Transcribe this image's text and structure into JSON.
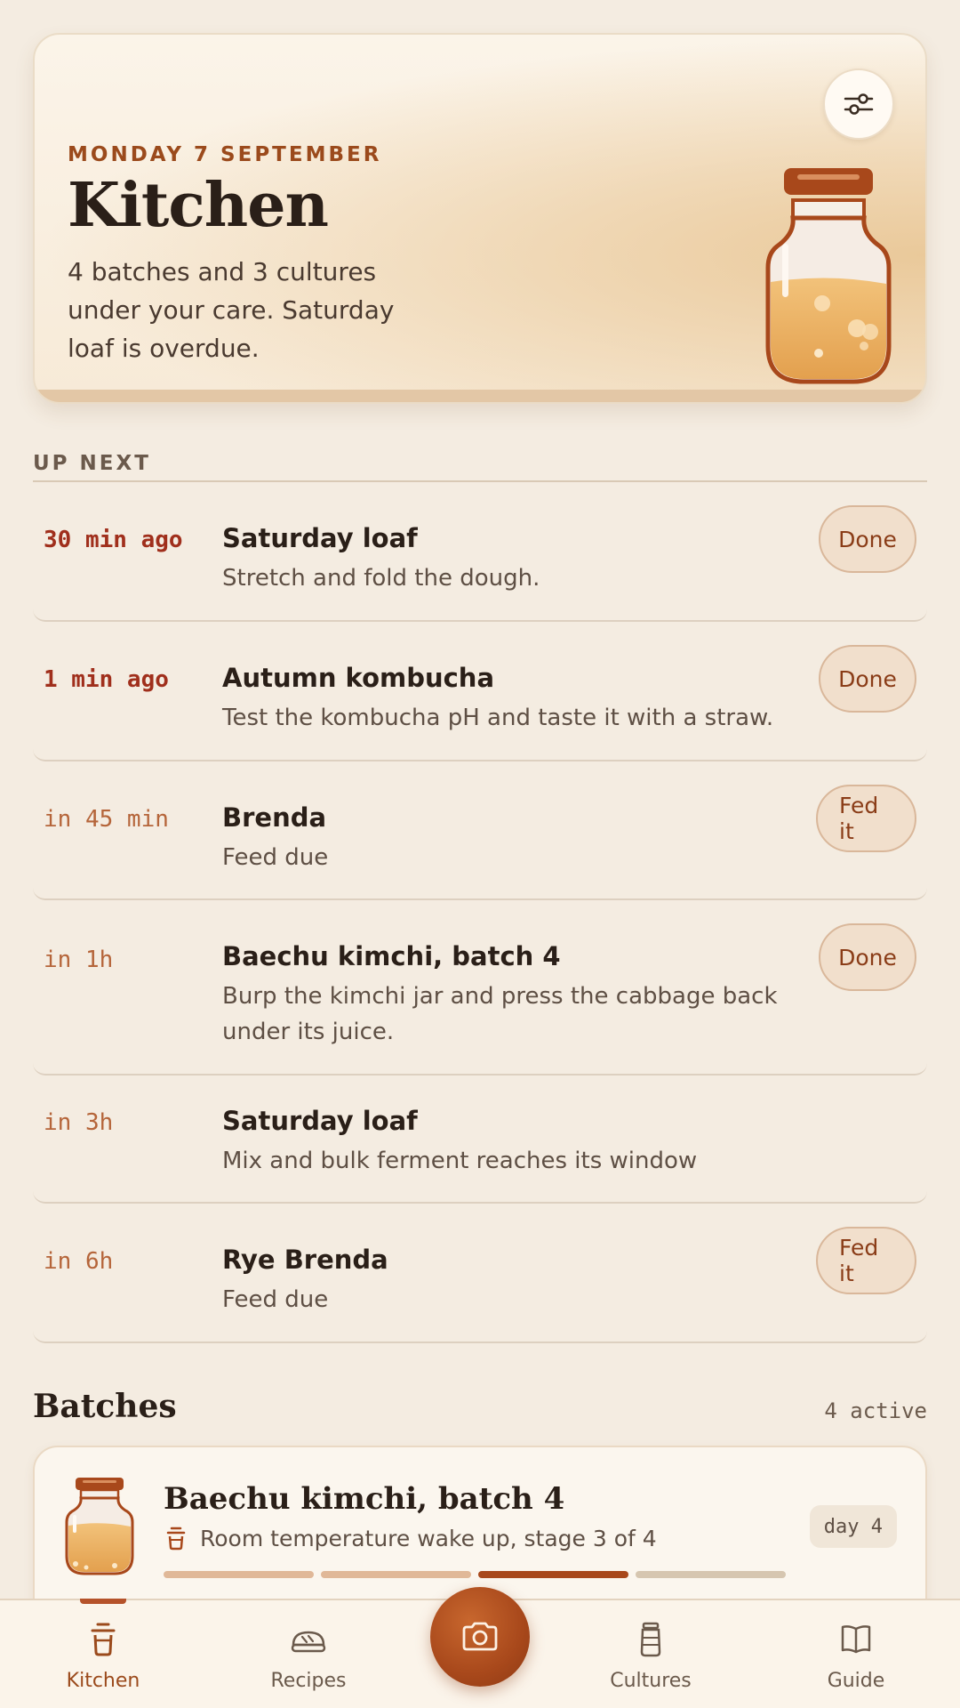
{
  "hero": {
    "date": "MONDAY 7 SEPTEMBER",
    "title": "Kitchen",
    "summary": "4 batches and 3 cultures under your care. Saturday loaf is overdue."
  },
  "up_next": {
    "label": "UP NEXT",
    "tasks": [
      {
        "time": "30 min ago",
        "title": "Saturday loaf",
        "desc": "Stretch and fold the dough.",
        "action": "Done",
        "overdue": true
      },
      {
        "time": "1 min ago",
        "title": "Autumn kombucha",
        "desc": "Test the kombucha pH and taste it with a straw.",
        "action": "Done",
        "overdue": true
      },
      {
        "time": "in 45 min",
        "title": "Brenda",
        "desc": "Feed due",
        "action": "Fed it",
        "overdue": false
      },
      {
        "time": "in 1h",
        "title": "Baechu kimchi, batch 4",
        "desc": "Burp the kimchi jar and press the cabbage back under its juice.",
        "action": "Done",
        "overdue": false
      },
      {
        "time": "in 3h",
        "title": "Saturday loaf",
        "desc": "Mix and bulk ferment reaches its window",
        "action": "",
        "overdue": false
      },
      {
        "time": "in 6h",
        "title": "Rye Brenda",
        "desc": "Feed due",
        "action": "Fed it",
        "overdue": false
      }
    ]
  },
  "batches": {
    "title": "Batches",
    "count": "4 active",
    "items": [
      {
        "title": "Baechu kimchi, batch 4",
        "stage": "Room temperature wake up, stage 3 of 4",
        "day": "day 4",
        "stage_current": 3,
        "stage_total": 4
      }
    ]
  },
  "nav": {
    "kitchen": "Kitchen",
    "recipes": "Recipes",
    "cultures": "Cultures",
    "guide": "Guide",
    "active": "Kitchen"
  },
  "colors": {
    "accent": "#9b4a1c",
    "overdue": "#a02f1c",
    "upcoming": "#b5653a",
    "background": "#f4ece1"
  },
  "icons": {
    "filter": "sliders-icon",
    "camera": "camera-icon",
    "kitchen": "jar-cup-icon",
    "recipes": "bread-icon",
    "cultures": "jar-icon",
    "guide": "book-icon"
  }
}
